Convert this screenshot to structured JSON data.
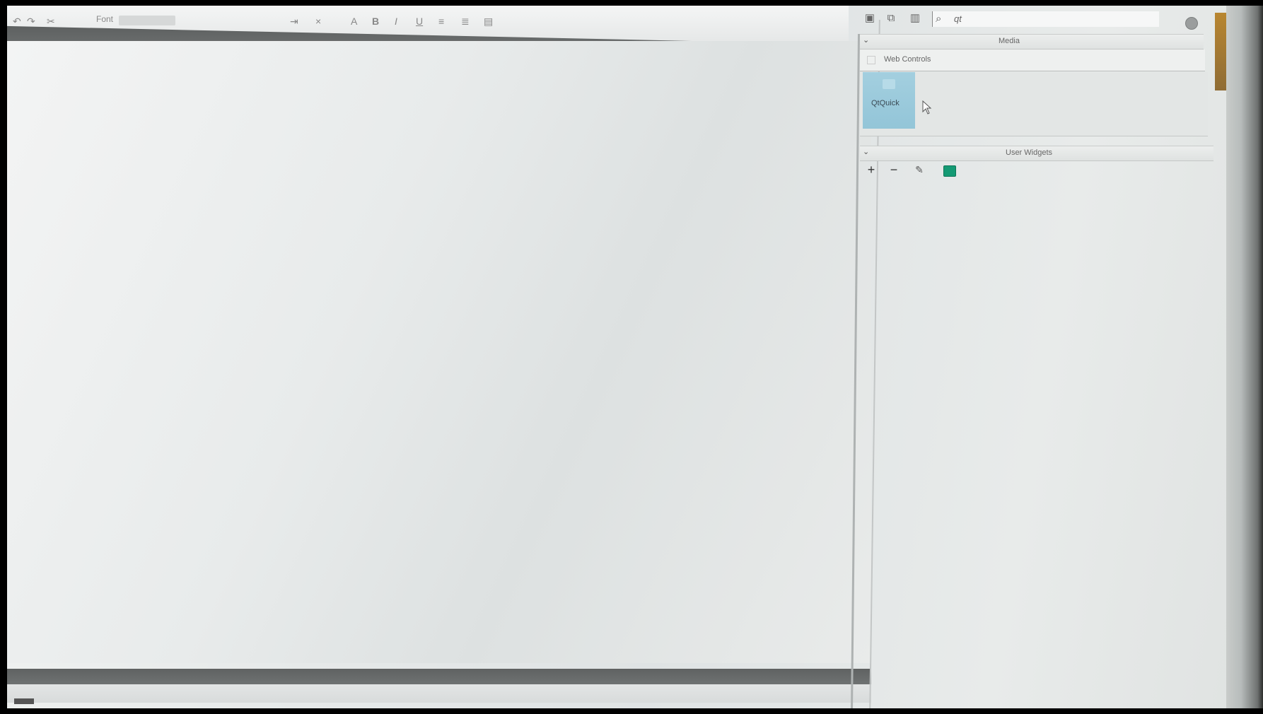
{
  "editor": {
    "toolbar_font_label": "Font",
    "toolbar_icons": [
      "font-color-icon",
      "bold-icon",
      "italic-icon",
      "underline-icon",
      "align-left-icon",
      "align-center-icon",
      "image-icon"
    ]
  },
  "panel": {
    "search": {
      "placeholder": "qt"
    },
    "sections": {
      "media": {
        "title": "Media"
      },
      "web_controls": {
        "label": "Web Controls"
      },
      "user_widgets": {
        "title": "User Widgets"
      }
    },
    "media_items": [
      {
        "label": "QtQuick",
        "selected": true
      }
    ],
    "user_widgets_toolbar": {
      "add": "+",
      "remove": "−",
      "edit": "✎",
      "color": "#149a74"
    }
  },
  "colors": {
    "selection": "#9ccbdc",
    "dark_bar": "#626565"
  }
}
